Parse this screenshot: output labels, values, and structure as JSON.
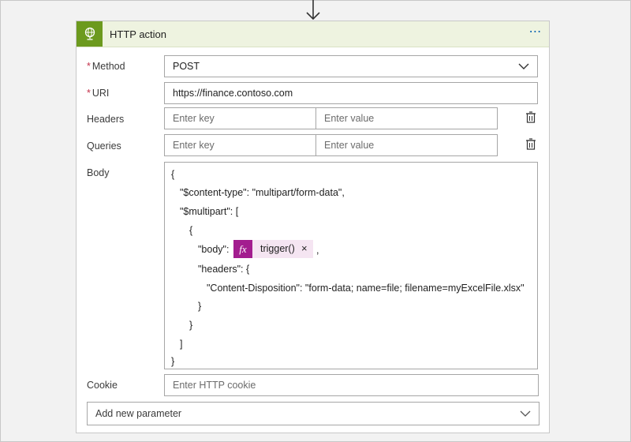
{
  "card": {
    "title": "HTTP action",
    "more_icon": "more-dots-icon",
    "header_icon": "globe-icon",
    "header_color": "#6c9a1e"
  },
  "method": {
    "label": "Method",
    "required": "*",
    "value": "POST"
  },
  "uri": {
    "label": "URI",
    "required": "*",
    "value": "https://finance.contoso.com"
  },
  "headers": {
    "label": "Headers",
    "key_placeholder": "Enter key",
    "value_placeholder": "Enter value"
  },
  "queries": {
    "label": "Queries",
    "key_placeholder": "Enter key",
    "value_placeholder": "Enter value"
  },
  "body": {
    "label": "Body",
    "lines": [
      "{",
      "\"$content-type\": \"multipart/form-data\",",
      "\"$multipart\": [",
      "{",
      "\"body\":",
      "\"headers\": {",
      "\"Content-Disposition\": \"form-data; name=file; filename=myExcelFile.xlsx\"",
      "}",
      "}",
      "]",
      "}"
    ],
    "token": {
      "fx": "fx",
      "label": "trigger()",
      "close": "×",
      "color": "#a31d8f"
    },
    "after_token": ","
  },
  "cookie": {
    "label": "Cookie",
    "placeholder": "Enter HTTP cookie"
  },
  "add_parameter": {
    "label": "Add new parameter"
  }
}
